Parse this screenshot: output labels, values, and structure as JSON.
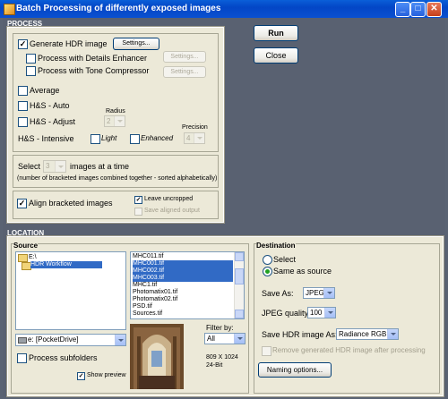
{
  "window": {
    "title": "Batch Processing of differently exposed images"
  },
  "process": {
    "header": "PROCESS",
    "generate_hdr": {
      "label": "Generate HDR image",
      "checked": true
    },
    "settings_label": "Settings...",
    "details_enhancer": {
      "label": "Process with Details Enhancer",
      "checked": false
    },
    "tone_compressor": {
      "label": "Process with Tone Compressor",
      "checked": false
    },
    "average": {
      "label": "Average"
    },
    "hs_auto": {
      "label": "H&S - Auto"
    },
    "hs_adjust": {
      "label": "H&S - Adjust"
    },
    "hs_intensive": {
      "label": "H&S - Intensive"
    },
    "radius": {
      "label": "Radius",
      "value": "2"
    },
    "precision": {
      "label": "Precision",
      "value": "4"
    },
    "light": {
      "label": "Light"
    },
    "enhanced": {
      "label": "Enhanced"
    },
    "select": {
      "prefix": "Select",
      "value": "3",
      "suffix": "images at a time",
      "note": "(number of bracketed images combined together - sorted alphabetically)"
    },
    "align": {
      "label": "Align bracketed images",
      "checked": true
    },
    "leave_uncropped": {
      "label": "Leave uncropped",
      "checked": true
    },
    "save_aligned": {
      "label": "Save aligned output",
      "checked": false
    }
  },
  "buttons": {
    "run": "Run",
    "close": "Close"
  },
  "location": {
    "header": "LOCATION",
    "source": {
      "header": "Source",
      "folders": [
        "E:\\",
        "HDR Workflow"
      ],
      "files": [
        "MHC011.tif",
        "MHC001.tif",
        "MHC002.tif",
        "MHC003.tif",
        "MHC1.tif",
        "Photomatix01.tif",
        "Photomatix02.tif",
        "PSD.tif",
        "Sources.tif"
      ],
      "selected_files": [
        1,
        2,
        3
      ],
      "drive": "e: [PocketDrive]",
      "filter_label": "Filter by:",
      "filter_value": "All",
      "dims": "809 X 1024",
      "bits": "24-Bit",
      "process_subfolders": {
        "label": "Process subfolders",
        "checked": false
      },
      "show_preview": {
        "label": "Show preview",
        "checked": true
      }
    },
    "destination": {
      "header": "Destination",
      "select_label": "Select",
      "same_as_source": "Same as source",
      "save_as_label": "Save As:",
      "save_as_value": "JPEG",
      "quality_label": "JPEG quality:",
      "quality_value": "100",
      "save_hdr_label": "Save HDR image As:",
      "save_hdr_value": "Radiance RGBE",
      "remove_label": "Remove generated HDR image after processing",
      "naming_label": "Naming options..."
    }
  }
}
